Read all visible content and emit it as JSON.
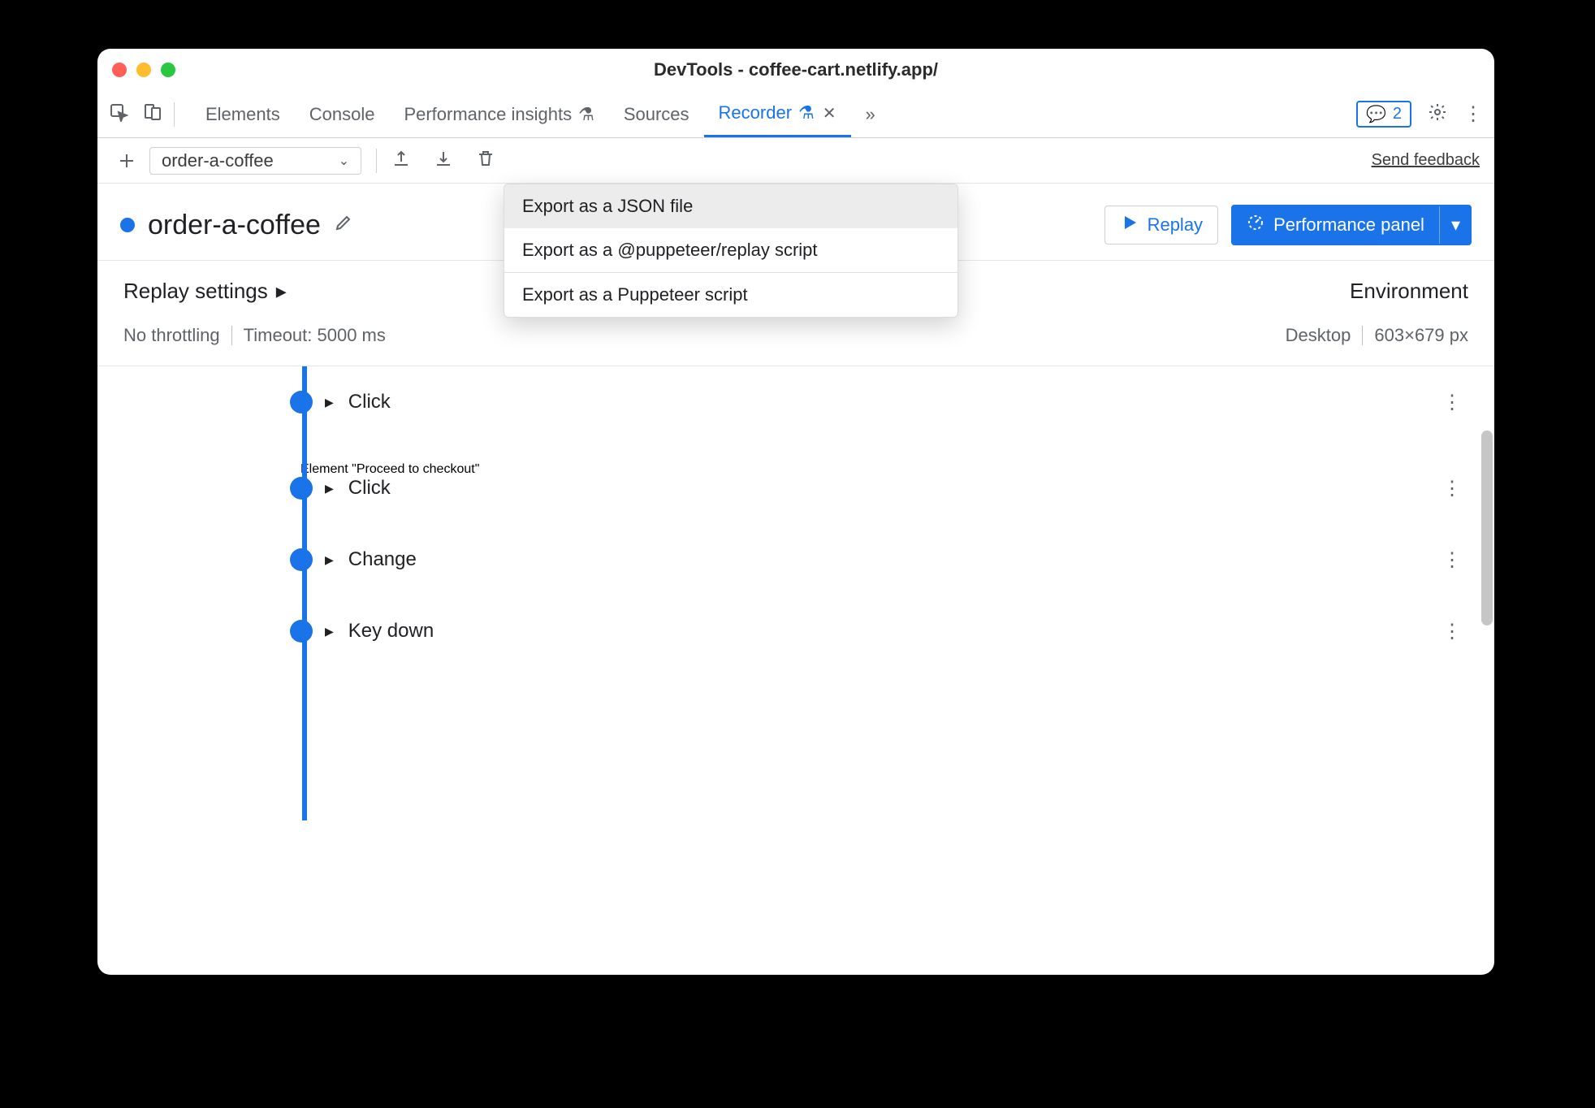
{
  "window": {
    "title": "DevTools - coffee-cart.netlify.app/"
  },
  "tabs": {
    "elements": "Elements",
    "console": "Console",
    "perf_insights": "Performance insights",
    "sources": "Sources",
    "recorder": "Recorder",
    "overflow": "»",
    "issues_count": "2"
  },
  "toolbar": {
    "recording_name": "order-a-coffee",
    "feedback": "Send feedback"
  },
  "export_menu": {
    "json": "Export as a JSON file",
    "pupp_replay": "Export as a @puppeteer/replay script",
    "pupp": "Export as a Puppeteer script"
  },
  "header": {
    "title": "order-a-coffee",
    "replay": "Replay",
    "perf_panel": "Performance panel"
  },
  "settings": {
    "replay_label": "Replay settings",
    "throttling": "No throttling",
    "timeout": "Timeout: 5000 ms",
    "env_label": "Environment",
    "env_device": "Desktop",
    "env_size": "603×679 px"
  },
  "steps": [
    {
      "type": "Click",
      "detail": "Element \"Proceed to checkout\""
    },
    {
      "type": "Click",
      "detail": ""
    },
    {
      "type": "Change",
      "detail": ""
    },
    {
      "type": "Key down",
      "detail": ""
    }
  ]
}
